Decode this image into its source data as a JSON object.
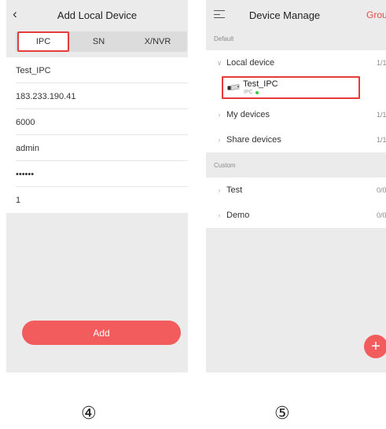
{
  "add_screen": {
    "title": "Add Local Device",
    "back_icon": "chevron-left-icon",
    "tabs": [
      {
        "label": "IPC",
        "selected": true
      },
      {
        "label": "SN",
        "selected": false
      },
      {
        "label": "X/NVR",
        "selected": false
      }
    ],
    "fields": [
      {
        "name": "device-name",
        "value": "Test_IPC"
      },
      {
        "name": "ip-address",
        "value": "183.233.190.41"
      },
      {
        "name": "port",
        "value": "6000"
      },
      {
        "name": "username",
        "value": "admin"
      },
      {
        "name": "password",
        "value": "••••••"
      },
      {
        "name": "channel",
        "value": "1"
      }
    ],
    "add_button": "Add"
  },
  "manage_screen": {
    "menu_icon": "menu-icon",
    "title": "Device Manage",
    "group_button": "Group",
    "sections": {
      "default_label": "Default",
      "custom_label": "Custom"
    },
    "default_groups": [
      {
        "label": "Local device",
        "count": "1/1",
        "expanded": true
      },
      {
        "label": "My devices",
        "count": "1/1",
        "expanded": false
      },
      {
        "label": "Share devices",
        "count": "1/1",
        "expanded": false
      }
    ],
    "device": {
      "name": "Test_IPC",
      "type": "IPC",
      "icon": "camera-icon",
      "online": true,
      "status_color": "#3dc93d"
    },
    "custom_groups": [
      {
        "label": "Test",
        "count": "0/0"
      },
      {
        "label": "Demo",
        "count": "0/0"
      }
    ],
    "fab_label": "+"
  },
  "steps": {
    "left": "④",
    "right": "⑤"
  },
  "colors": {
    "accent": "#f25c5c",
    "highlight_border": "#e53b3b",
    "online": "#3dc93d"
  }
}
